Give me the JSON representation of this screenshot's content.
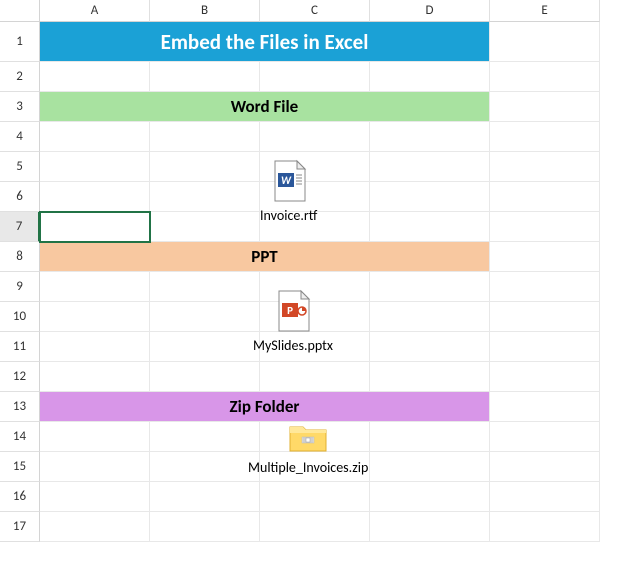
{
  "columns": [
    "A",
    "B",
    "C",
    "D",
    "E"
  ],
  "rows": [
    "1",
    "2",
    "3",
    "4",
    "5",
    "6",
    "7",
    "8",
    "9",
    "10",
    "11",
    "12",
    "13",
    "14",
    "15",
    "16",
    "17"
  ],
  "title": "Embed the Files in Excel",
  "sections": {
    "word": {
      "header": "Word File",
      "filename": "Invoice.rtf"
    },
    "ppt": {
      "header": "PPT",
      "filename": "MySlides.pptx"
    },
    "zip": {
      "header": "Zip Folder",
      "filename": "Multiple_Invoices.zip"
    }
  },
  "selected_row": "7"
}
